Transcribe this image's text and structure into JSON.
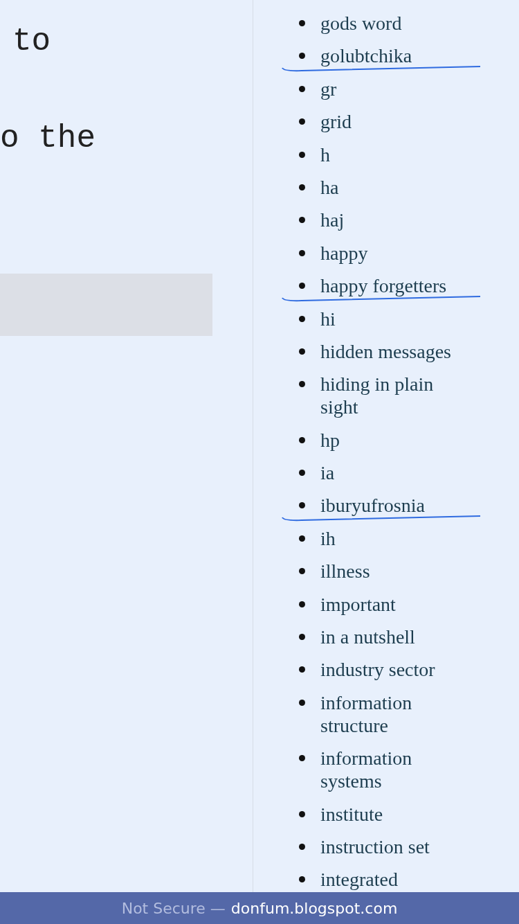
{
  "article": {
    "lines": [
      "to",
      "o the"
    ]
  },
  "label_list": {
    "items": [
      {
        "text": "gods word",
        "underlined": false
      },
      {
        "text": "golubtchika",
        "underlined": true
      },
      {
        "text": "gr",
        "underlined": false
      },
      {
        "text": "grid",
        "underlined": false
      },
      {
        "text": "h",
        "underlined": false
      },
      {
        "text": "ha",
        "underlined": false
      },
      {
        "text": "haj",
        "underlined": false
      },
      {
        "text": "happy",
        "underlined": false
      },
      {
        "text": "happy forgetters",
        "underlined": true
      },
      {
        "text": "hi",
        "underlined": false
      },
      {
        "text": "hidden messages",
        "underlined": false
      },
      {
        "text": "hiding in plain sight",
        "underlined": false
      },
      {
        "text": "hp",
        "underlined": false
      },
      {
        "text": "ia",
        "underlined": false
      },
      {
        "text": "iburyufrosnia",
        "underlined": true
      },
      {
        "text": "ih",
        "underlined": false
      },
      {
        "text": "illness",
        "underlined": false
      },
      {
        "text": "important",
        "underlined": false
      },
      {
        "text": "in a nutshell",
        "underlined": false
      },
      {
        "text": "industry sector",
        "underlined": false
      },
      {
        "text": "information structure",
        "underlined": false
      },
      {
        "text": "information systems",
        "underlined": false
      },
      {
        "text": "institute",
        "underlined": false
      },
      {
        "text": "instruction set",
        "underlined": false
      },
      {
        "text": "integrated",
        "underlined": false
      }
    ]
  },
  "address_bar": {
    "security": "Not Secure —",
    "domain": "donfum.blogspot.com"
  }
}
